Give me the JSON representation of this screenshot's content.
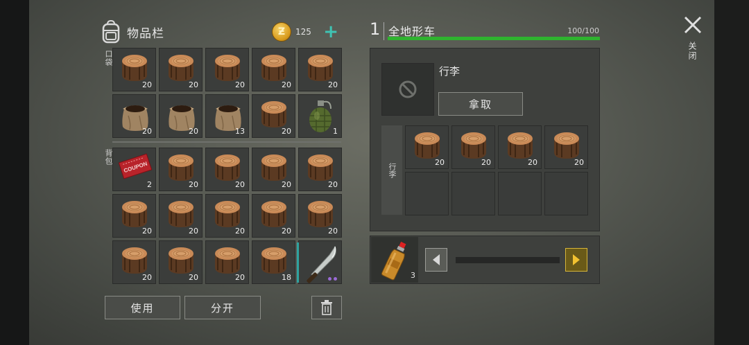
{
  "inventory": {
    "title": "物品栏",
    "coins": "125",
    "pocket_label": "口袋",
    "backpack_label": "背包",
    "pocket_slots": [
      {
        "item": "wood-log",
        "count": "20"
      },
      {
        "item": "wood-log",
        "count": "20"
      },
      {
        "item": "wood-log",
        "count": "20"
      },
      {
        "item": "wood-log",
        "count": "20"
      },
      {
        "item": "wood-log",
        "count": "20"
      },
      {
        "item": "soil-sack",
        "count": "20"
      },
      {
        "item": "soil-sack",
        "count": "20"
      },
      {
        "item": "soil-sack",
        "count": "13"
      },
      {
        "item": "wood-log",
        "count": "20"
      },
      {
        "item": "grenade",
        "count": "1"
      }
    ],
    "backpack_slots": [
      {
        "item": "coupon",
        "count": "2"
      },
      {
        "item": "wood-log",
        "count": "20"
      },
      {
        "item": "wood-log",
        "count": "20"
      },
      {
        "item": "wood-log",
        "count": "20"
      },
      {
        "item": "wood-log",
        "count": "20"
      },
      {
        "item": "wood-log",
        "count": "20"
      },
      {
        "item": "wood-log",
        "count": "20"
      },
      {
        "item": "wood-log",
        "count": "20"
      },
      {
        "item": "wood-log",
        "count": "20"
      },
      {
        "item": "wood-log",
        "count": "20"
      },
      {
        "item": "wood-log",
        "count": "20"
      },
      {
        "item": "wood-log",
        "count": "20"
      },
      {
        "item": "wood-log",
        "count": "20"
      },
      {
        "item": "wood-log",
        "count": "18"
      },
      {
        "item": "machete",
        "count": ""
      }
    ],
    "coupon_text": "COUPON",
    "use_label": "使用",
    "split_label": "分开"
  },
  "vehicle": {
    "number": "1",
    "name": "全地形车",
    "durability": "100/100",
    "durability_fraction": 1.0,
    "luggage_title": "行李",
    "take_label": "拿取",
    "luggage_column_label": "行李",
    "luggage_slots": [
      {
        "item": "wood-log",
        "count": "20"
      },
      {
        "item": "wood-log",
        "count": "20"
      },
      {
        "item": "wood-log",
        "count": "20"
      },
      {
        "item": "wood-log",
        "count": "20"
      }
    ],
    "fuel_count": "3"
  },
  "close_label": "关闭",
  "colors": {
    "accent_teal": "#3fc3b3",
    "hp_green": "#2fb32f",
    "arrow_gold": "#d7b53a"
  }
}
